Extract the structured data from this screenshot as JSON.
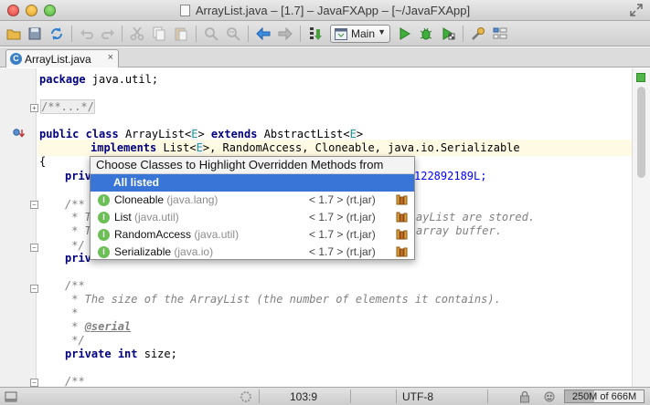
{
  "window": {
    "title": "ArrayList.java – [1.7] – JavaFXApp – [~/JavaFXApp]"
  },
  "toolbar": {
    "run_config": "Main",
    "icons": [
      "open-folder-icon",
      "save-icon",
      "sync-icon",
      "undo-icon",
      "redo-icon",
      "cut-icon",
      "copy-icon",
      "paste-icon",
      "find-icon",
      "replace-icon",
      "back-icon",
      "forward-icon",
      "make-icon",
      "run-icon",
      "debug-icon",
      "coverage-icon",
      "settings-icon",
      "structure-icon"
    ]
  },
  "editor_tab": {
    "label": "ArrayList.java",
    "icon": "class-c-icon",
    "icon_letter": "C"
  },
  "code": {
    "package_kw": "package",
    "package_name": " java.util;",
    "folded_comment": "/**...*/",
    "class_line": {
      "kw_public": "public",
      "kw_class": "class",
      "name": " ArrayList<",
      "type_param": "E",
      "after_tp": "> ",
      "kw_extends": "extends",
      "super": " AbstractList<",
      "type_param2": "E",
      "close": ">"
    },
    "implements_line": {
      "kw": "implements",
      "list": " List<",
      "tp": "E",
      "rest": ">, RandomAccess, Cloneable, java.io.Serializable"
    },
    "brace_open": "{",
    "field1_kw": "priv",
    "field1_tail": "122892189L;",
    "c1_l1": "/**",
    "c1_l2": " * T",
    "c1_l2_tail": "ayList are stored.",
    "c1_l3": " * T",
    "c1_l3_tail": "array buffer.",
    "c1_l4": " */",
    "field2_kw": "priv",
    "c2_l1": "/**",
    "c2_l2": " * The size of the ArrayList (the number of elements it contains).",
    "c2_l3": " *",
    "c2_l4_prefix": " * ",
    "c2_l4_tag": "@serial",
    "c2_l5": " */",
    "size_kw_private": "private",
    "size_kw_int": "int",
    "size_name": " size;",
    "c3_l1": "/**"
  },
  "popup": {
    "title": "Choose Classes to Highlight Overridden Methods from",
    "selected": "All listed",
    "items": [
      {
        "name": "Cloneable",
        "package": " (java.lang)",
        "version": "< 1.7 > (rt.jar)",
        "icon_letter": "I"
      },
      {
        "name": "List",
        "package": " (java.util)",
        "version": "< 1.7 > (rt.jar)",
        "icon_letter": "I"
      },
      {
        "name": "RandomAccess",
        "package": " (java.util)",
        "version": "< 1.7 > (rt.jar)",
        "icon_letter": "I"
      },
      {
        "name": "Serializable",
        "package": " (java.io)",
        "version": "< 1.7 > (rt.jar)",
        "icon_letter": "I"
      }
    ]
  },
  "status": {
    "position": "103:9",
    "encoding": "UTF-8",
    "memory": "250M of 666M",
    "memory_used_fraction": 0.375
  },
  "colors": {
    "keyword": "#000080",
    "type_param": "#20999d",
    "comment": "#808080",
    "number": "#0000ff",
    "selection": "#3875d7",
    "interface_icon": "#6cbf55",
    "class_icon": "#3b7fc4"
  }
}
